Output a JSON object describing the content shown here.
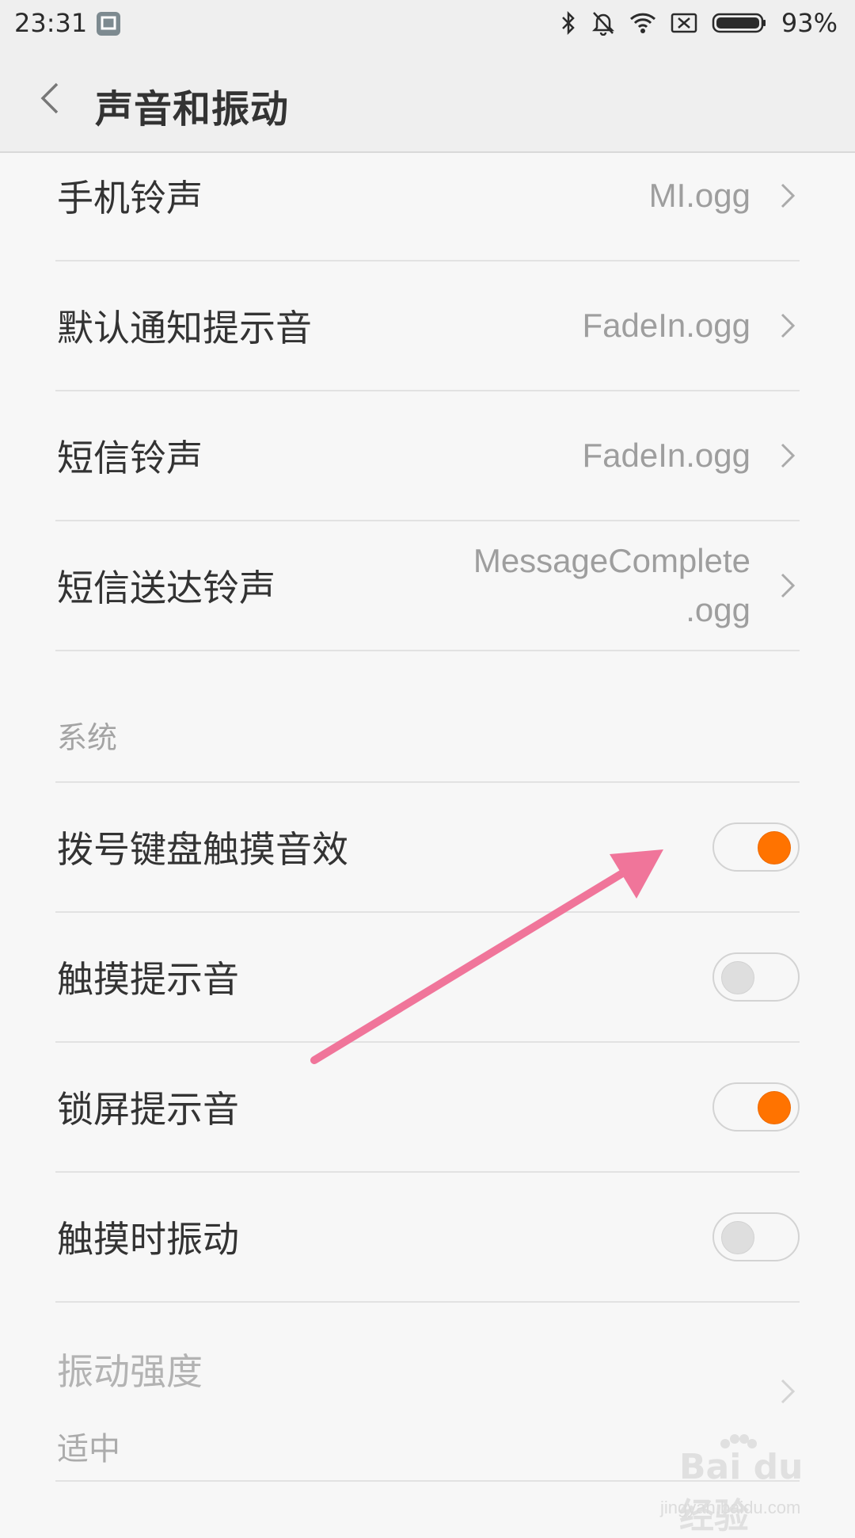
{
  "status_bar": {
    "time": "23:31",
    "battery_percent": "93%",
    "icons": [
      "notification-icon",
      "bluetooth-icon",
      "mute-bell-icon",
      "wifi-icon",
      "no-sim-icon",
      "battery-icon"
    ]
  },
  "app_bar": {
    "title": "声音和振动"
  },
  "ringtones": [
    {
      "label": "手机铃声",
      "value": "MI.ogg"
    },
    {
      "label": "默认通知提示音",
      "value": "FadeIn.ogg"
    },
    {
      "label": "短信铃声",
      "value": "FadeIn.ogg"
    },
    {
      "label": "短信送达铃声",
      "value_line1": "MessageComplete",
      "value_line2": ".ogg"
    }
  ],
  "system_section": {
    "header": "系统",
    "toggles": [
      {
        "label": "拨号键盘触摸音效",
        "on": true
      },
      {
        "label": "触摸提示音",
        "on": false
      },
      {
        "label": "锁屏提示音",
        "on": true
      },
      {
        "label": "触摸时振动",
        "on": false
      }
    ],
    "vibration": {
      "label": "振动强度",
      "value": "适中",
      "enabled": false
    }
  },
  "colors": {
    "accent": "#ff7300",
    "annotation_arrow": "#f0759a"
  },
  "watermark": {
    "brand": "Bai du 经验",
    "url": "jingyan.baidu.com"
  }
}
